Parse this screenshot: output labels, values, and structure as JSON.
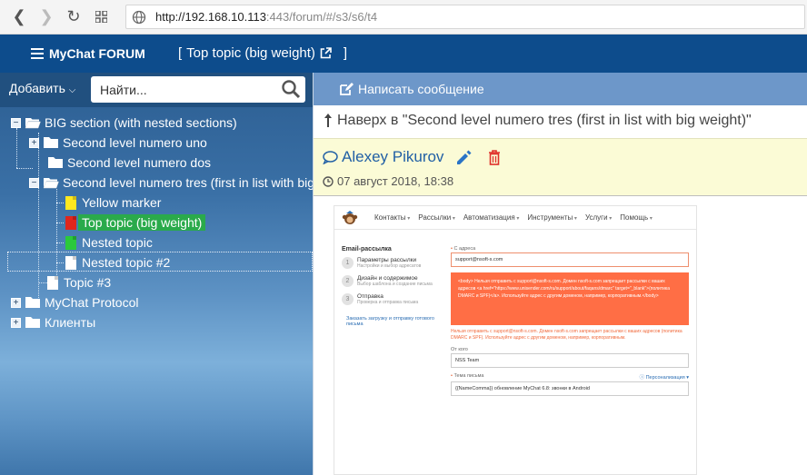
{
  "browser": {
    "url_host": "http://192.168.10.113",
    "url_rest": ":443/forum/#/s3/s6/t4"
  },
  "header": {
    "brand": "MyChat FORUM",
    "breadcrumb_open": "[",
    "breadcrumb_title": "Top topic (big weight)",
    "breadcrumb_close": "]"
  },
  "sidebar": {
    "add_label": "Добавить",
    "search_placeholder": "Найти...",
    "tree": [
      {
        "label": "BIG section (with nested sections)",
        "kind": "folder-open",
        "toggle": "−"
      },
      {
        "label": "Second level numero uno",
        "kind": "folder",
        "toggle": "+"
      },
      {
        "label": "Second level numero dos",
        "kind": "folder",
        "toggle": ""
      },
      {
        "label": "Second level numero tres (first in list with big weight)",
        "kind": "folder-open",
        "toggle": "−"
      },
      {
        "label": "Yellow marker",
        "kind": "doc",
        "color": "#ffe81f"
      },
      {
        "label": "Top topic (big weight)",
        "kind": "doc",
        "color": "#e0261d"
      },
      {
        "label": "Nested topic",
        "kind": "doc",
        "color": "#2bc93b"
      },
      {
        "label": "Nested topic #2",
        "kind": "doc",
        "color": "#ffffff"
      },
      {
        "label": "Topic #3",
        "kind": "doc",
        "color": "#ffffff"
      },
      {
        "label": "MyChat Protocol",
        "kind": "folder",
        "toggle": "+"
      },
      {
        "label": "Клиенты",
        "kind": "folder",
        "toggle": "+"
      }
    ]
  },
  "main": {
    "compose_label": "Написать сообщение",
    "up_label": "Наверх в \"Second level numero tres (first in list with big weight)\"",
    "author": "Alexey Pikurov",
    "date": "07 август 2018, 18:38"
  },
  "screenshot": {
    "menu": [
      "Контакты",
      "Рассылки",
      "Автоматизация",
      "Инструменты",
      "Услуги",
      "Помощь"
    ],
    "side_title": "Email-рассылка",
    "steps": [
      {
        "n": "1",
        "title": "Параметры рассылки",
        "sub": "Настройки и выбор адресатов"
      },
      {
        "n": "2",
        "title": "Дизайн и содержимое",
        "sub": "Выбор шаблона и создание письма"
      },
      {
        "n": "3",
        "title": "Отправка",
        "sub": "Проверка и отправка письма"
      }
    ],
    "side_link": "Заказать загрузку и отправку готового письма",
    "from_label": "С адреса",
    "from_value": "support@nsoft-s.com",
    "error_box": "<body> Нельзя отправить с support@nsoft-s.com. Домен nsoft-s.com запрещает рассылки с ваших адресов <a href=\"https://www.unisender.com/ru/support/about/faqans/dmarc\" target=\"_blank\">(политика DMARC и SPF)</a>. Используйте адрес с другим доменом, например, корпоративным.</body>",
    "error_text": "Нельзя отправить с support@nsoft-s.com. Домен nsoft-s.com запрещает рассылки с ваших адресов (политика DMARC и SPF). Используйте адрес с другим доменом, например, корпоративным.",
    "name_label": "От кого",
    "name_value": "NSS Team",
    "subject_label": "Тема письма",
    "personalize": "Персонализация",
    "subject_value": "{{NameComma}} обновление MyChat 6.8: звонки в Android"
  }
}
